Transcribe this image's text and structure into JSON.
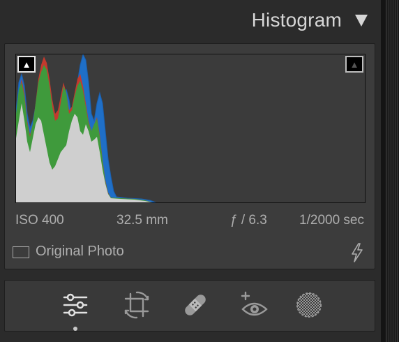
{
  "header": {
    "title": "Histogram",
    "toggle_icon": "triangle-down-icon"
  },
  "histogram": {
    "shadow_clipping_icon": "triangle-up-icon",
    "highlight_clipping_icon": "triangle-up-icon",
    "colors": {
      "red": "#c33a2e",
      "green": "#3f9a3c",
      "blue": "#1f6fc7",
      "luminance": "#cfcfcf"
    }
  },
  "metadata": {
    "iso": "ISO 400",
    "focal_length": "32.5 mm",
    "aperture": "ƒ / 6.3",
    "shutter": "1/2000 sec"
  },
  "original_photo": {
    "label": "Original Photo",
    "checked": false,
    "flash_icon": "flash-icon"
  },
  "tools": [
    {
      "name": "edit",
      "icon": "sliders-icon",
      "active": true
    },
    {
      "name": "crop",
      "icon": "crop-rotate-icon",
      "active": false
    },
    {
      "name": "healing",
      "icon": "bandage-icon",
      "active": false
    },
    {
      "name": "red-eye",
      "icon": "red-eye-icon",
      "active": false
    },
    {
      "name": "masking",
      "icon": "mask-icon",
      "active": false
    }
  ]
}
